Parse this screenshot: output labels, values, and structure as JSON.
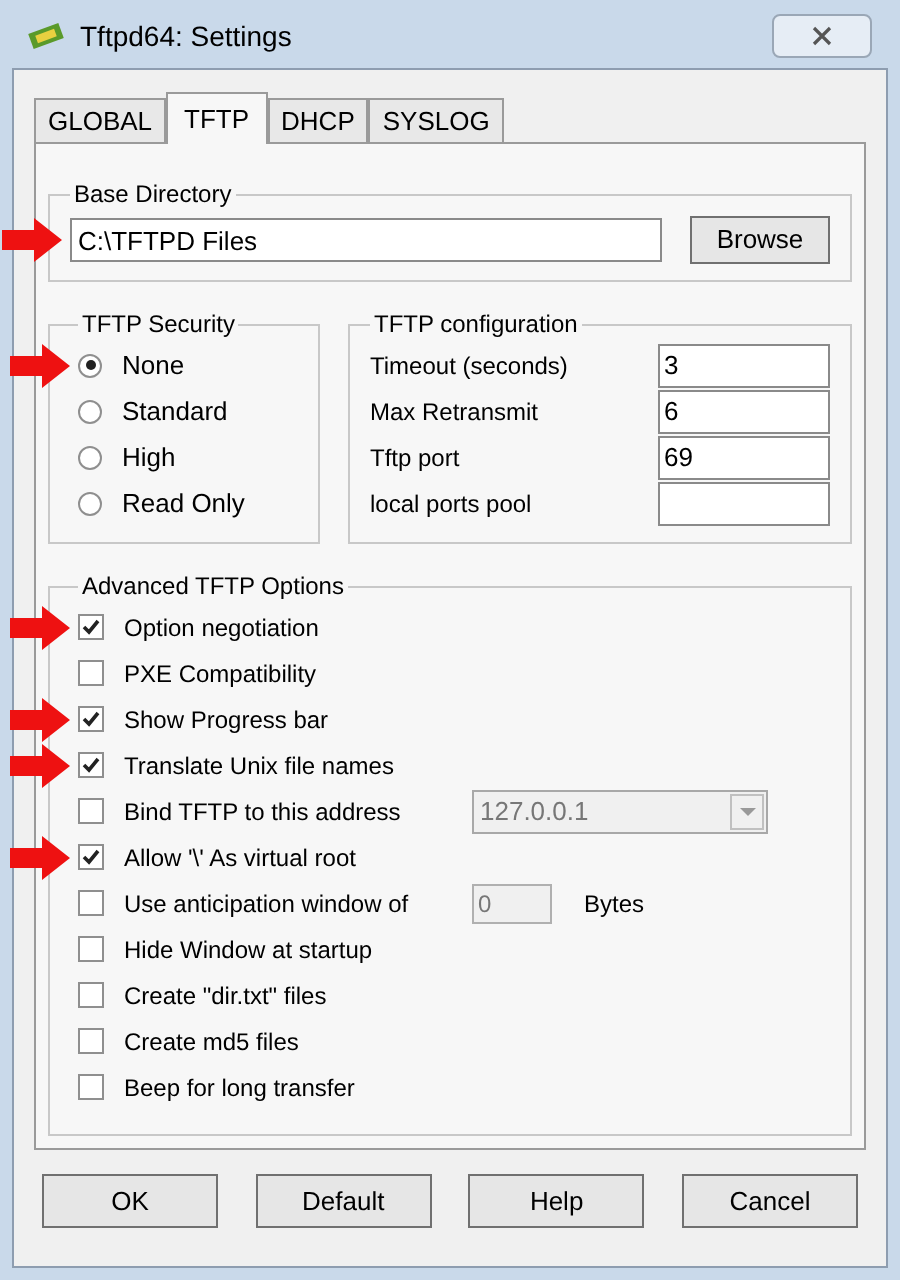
{
  "window": {
    "title": "Tftpd64: Settings"
  },
  "tabs": [
    {
      "label": "GLOBAL",
      "selected": false
    },
    {
      "label": "TFTP",
      "selected": true
    },
    {
      "label": "DHCP",
      "selected": false
    },
    {
      "label": "SYSLOG",
      "selected": false
    }
  ],
  "base_directory": {
    "title": "Base Directory",
    "value": "C:\\TFTPD Files",
    "marked": true,
    "button": "Browse"
  },
  "security": {
    "title": "TFTP Security",
    "options": [
      {
        "label": "None",
        "selected": true,
        "marked": true
      },
      {
        "label": "Standard",
        "selected": false,
        "marked": false
      },
      {
        "label": "High",
        "selected": false,
        "marked": false
      },
      {
        "label": "Read Only",
        "selected": false,
        "marked": false
      }
    ]
  },
  "configuration": {
    "title": "TFTP configuration",
    "fields": [
      {
        "label": "Timeout (seconds)",
        "value": "3"
      },
      {
        "label": "Max Retransmit",
        "value": "6"
      },
      {
        "label": "Tftp port",
        "value": "69"
      },
      {
        "label": "local ports pool"
      }
    ]
  },
  "advanced": {
    "title": "Advanced TFTP Options",
    "options": [
      {
        "kind": "check",
        "label": "Option negotiation",
        "checked": true,
        "marked": true
      },
      {
        "kind": "check",
        "label": "PXE Compatibility",
        "checked": false,
        "marked": false
      },
      {
        "kind": "check",
        "label": "Show Progress bar",
        "checked": true,
        "marked": true
      },
      {
        "kind": "check",
        "label": "Translate Unix file names",
        "checked": true,
        "marked": true
      },
      {
        "kind": "dropdown",
        "label": "Bind TFTP to this address",
        "checked": false,
        "marked": false,
        "value": "127.0.0.1"
      },
      {
        "kind": "check",
        "label": "Allow '\\' As virtual root",
        "checked": true,
        "marked": true
      },
      {
        "kind": "number",
        "label": "Use anticipation window of",
        "checked": false,
        "marked": false,
        "value": "0",
        "unit": "Bytes"
      },
      {
        "kind": "check",
        "label": "Hide Window at startup",
        "checked": false,
        "marked": false
      },
      {
        "kind": "check",
        "label": "Create \"dir.txt\" files",
        "checked": false,
        "marked": false
      },
      {
        "kind": "check",
        "label": "Create md5 files",
        "checked": false,
        "marked": false
      },
      {
        "kind": "check",
        "label": "Beep for long transfer",
        "checked": false,
        "marked": false
      }
    ]
  },
  "buttons": [
    "OK",
    "Default",
    "Help",
    "Cancel"
  ]
}
